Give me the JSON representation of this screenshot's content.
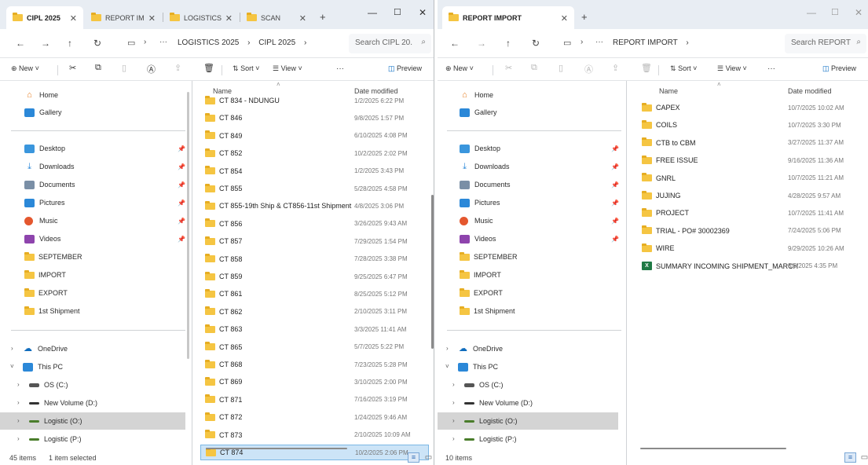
{
  "left": {
    "tabs": [
      "CIPL 2025",
      "REPORT IM",
      "LOGISTICS",
      "SCAN"
    ],
    "breadcrumb": [
      "LOGISTICS 2025",
      "CIPL 2025"
    ],
    "search": "Search CIPL 20.",
    "toolbar": {
      "new": "New",
      "sort": "Sort",
      "view": "View",
      "more": "···",
      "preview": "Preview"
    },
    "columns": {
      "name": "Name",
      "date": "Date modified"
    },
    "files": [
      {
        "name": "CT 834 - NDUNGU",
        "date": "1/2/2025 6:22 PM"
      },
      {
        "name": "CT 846",
        "date": "9/8/2025 1:57 PM"
      },
      {
        "name": "CT 849",
        "date": "6/10/2025 4:08 PM"
      },
      {
        "name": "CT 852",
        "date": "10/2/2025 2:02 PM"
      },
      {
        "name": "CT 854",
        "date": "1/2/2025 3:43 PM"
      },
      {
        "name": "CT 855",
        "date": "5/28/2025 4:58 PM"
      },
      {
        "name": "CT 855-19th Ship & CT856-11st Shipment",
        "date": "4/8/2025 3:06 PM"
      },
      {
        "name": "CT 856",
        "date": "3/26/2025 9:43 AM"
      },
      {
        "name": "CT 857",
        "date": "7/29/2025 1:54 PM"
      },
      {
        "name": "CT 858",
        "date": "7/28/2025 3:38 PM"
      },
      {
        "name": "CT 859",
        "date": "9/25/2025 6:47 PM"
      },
      {
        "name": "CT 861",
        "date": "8/25/2025 5:12 PM"
      },
      {
        "name": "CT 862",
        "date": "2/10/2025 3:11 PM"
      },
      {
        "name": "CT 863",
        "date": "3/3/2025 11:41 AM"
      },
      {
        "name": "CT 865",
        "date": "5/7/2025 5:22 PM"
      },
      {
        "name": "CT 868",
        "date": "7/23/2025 5:28 PM"
      },
      {
        "name": "CT 869",
        "date": "3/10/2025 2:00 PM"
      },
      {
        "name": "CT 871",
        "date": "7/16/2025 3:19 PM"
      },
      {
        "name": "CT 872",
        "date": "1/24/2025 9:46 AM"
      },
      {
        "name": "CT 873",
        "date": "2/10/2025 10:09 AM"
      },
      {
        "name": "CT 874",
        "date": "10/2/2025 2:06 PM"
      }
    ],
    "status": {
      "count": "45 items",
      "selected": "1 item selected"
    }
  },
  "right": {
    "tabs": [
      "REPORT IMPORT"
    ],
    "breadcrumb": [
      "REPORT IMPORT"
    ],
    "search": "Search REPORT",
    "toolbar": {
      "new": "New",
      "sort": "Sort",
      "view": "View",
      "more": "···",
      "preview": "Preview"
    },
    "columns": {
      "name": "Name",
      "date": "Date modified"
    },
    "files": [
      {
        "name": "CAPEX",
        "date": "10/7/2025 10:02 AM",
        "kind": "folder"
      },
      {
        "name": "COILS",
        "date": "10/7/2025 3:30 PM",
        "kind": "folder"
      },
      {
        "name": "CTB to CBM",
        "date": "3/27/2025 11:37 AM",
        "kind": "folder"
      },
      {
        "name": "FREE ISSUE",
        "date": "9/16/2025 11:36 AM",
        "kind": "folder"
      },
      {
        "name": "GNRL",
        "date": "10/7/2025 11:21 AM",
        "kind": "folder"
      },
      {
        "name": "JUJING",
        "date": "4/28/2025 9:57 AM",
        "kind": "folder"
      },
      {
        "name": "PROJECT",
        "date": "10/7/2025 11:41 AM",
        "kind": "folder"
      },
      {
        "name": "TRIAL - PO# 30002369",
        "date": "7/24/2025 5:06 PM",
        "kind": "folder"
      },
      {
        "name": "WIRE",
        "date": "9/29/2025 10:26 AM",
        "kind": "folder"
      },
      {
        "name": "SUMMARY INCOMING SHIPMENT_MARCH",
        "date": "3/3/2025 4:35 PM",
        "kind": "excel"
      }
    ],
    "status": {
      "count": "10 items"
    }
  },
  "nav": {
    "quick": [
      "Home",
      "Gallery"
    ],
    "pinned": [
      "Desktop",
      "Downloads",
      "Documents",
      "Pictures",
      "Music",
      "Videos"
    ],
    "folders": [
      "SEPTEMBER",
      "IMPORT",
      "EXPORT",
      "1st Shipment"
    ],
    "tree": [
      "OneDrive",
      "This PC",
      "OS (C:)",
      "New Volume (D:)",
      "Logistic (O:)",
      "Logistic (P:)"
    ]
  },
  "colors": {
    "accent": "#0067c0",
    "folder": "#f5c542",
    "selected_row": "#cce4f7",
    "tabbar": "#e8edf3"
  },
  "icons": [
    "folder-icon",
    "home-icon",
    "gallery-icon",
    "desktop-icon",
    "download-icon",
    "documents-icon",
    "pictures-icon",
    "music-icon",
    "videos-icon",
    "onedrive-icon",
    "pc-icon",
    "drive-icon",
    "excel-icon",
    "pin-icon",
    "search-icon",
    "cut-icon",
    "copy-icon",
    "paste-icon",
    "rename-icon",
    "share-icon",
    "delete-icon",
    "sort-icon",
    "view-icon",
    "preview-icon"
  ]
}
